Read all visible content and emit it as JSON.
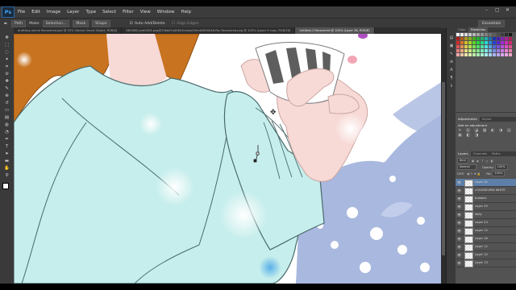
{
  "app": {
    "logo": "Ps"
  },
  "menubar": {
    "items": [
      "File",
      "Edit",
      "Image",
      "Layer",
      "Type",
      "Select",
      "Filter",
      "View",
      "Window",
      "Help"
    ],
    "window_controls": [
      "–",
      "▢",
      "✕"
    ]
  },
  "options": {
    "fields": [
      "Path",
      "Make:",
      "Selection...",
      "Mask",
      "Shape"
    ],
    "auto_add_delete": "Auto Add/Delete",
    "align_edges": "Align Edges",
    "workspace": "Essentials"
  },
  "tabs": [
    {
      "label": "draftAng anime Recovered.psd @ 25% (Vector Smart Object, RGB/8)",
      "active": false
    },
    {
      "label": "DB5086_lord0003.png@19bbd7a40603cepho0lVmb5856048.Pac Recovered.png @ 100% (Layer 9 copy, RGB/16)",
      "active": false
    },
    {
      "label": "Untitled-1 Recovered @ 100% (Layer 36, RGB/8)",
      "active": true
    }
  ],
  "panels": {
    "color_tabs": [
      "Color",
      "Swatches"
    ],
    "adjust_tabs": [
      "Adjustments",
      "Styles"
    ],
    "adjust_title": "Add an adjustment",
    "adjust_icons": "☀ ▥ ◪ ▦ ◐ ◑ ▤ ▣ ◧ ◨",
    "layer_tabs": [
      "Layers",
      "Channels",
      "Paths"
    ],
    "kind_label": "Kind",
    "blend_mode": "Normal",
    "opacity_label": "Opacity:",
    "opacity_value": "100%",
    "lock_label": "Lock:",
    "fill_label": "Fill:",
    "fill_value": "100%",
    "layers": [
      "Layer 34",
      "LOGODEVIEW WHITE",
      "bubble2",
      "Layer 29",
      "daily",
      "Layer 23",
      "Layer 15",
      "Layer 16",
      "Layer 12",
      "Layer 10",
      "Layer 13"
    ],
    "selected_layer": "Layer 34"
  },
  "colors": {
    "sweater": "#c6eeec",
    "sweater_line": "#4a6a6c",
    "hair": "#c8731f",
    "skin": "#f7d9d6",
    "snow_blue": "#a9b8df",
    "selection_blue": "#5d7fa8"
  }
}
